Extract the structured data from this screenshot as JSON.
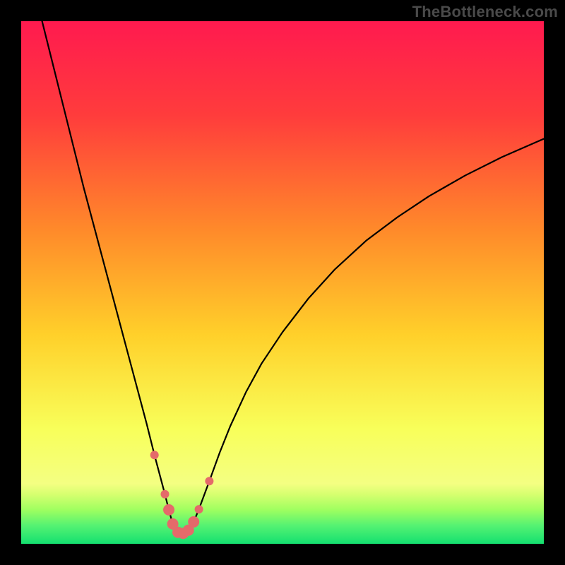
{
  "watermark": "TheBottleneck.com",
  "chart_data": {
    "type": "line",
    "title": "",
    "xlabel": "",
    "ylabel": "",
    "xlim": [
      0,
      100
    ],
    "ylim": [
      0,
      100
    ],
    "background": {
      "type": "vertical-gradient",
      "stops": [
        {
          "pos": 0.0,
          "color": "#ff1a4f"
        },
        {
          "pos": 0.18,
          "color": "#ff3c3c"
        },
        {
          "pos": 0.4,
          "color": "#ff8a2a"
        },
        {
          "pos": 0.6,
          "color": "#ffd02a"
        },
        {
          "pos": 0.78,
          "color": "#f8ff5a"
        },
        {
          "pos": 0.885,
          "color": "#f4ff82"
        },
        {
          "pos": 0.905,
          "color": "#d7ff70"
        },
        {
          "pos": 0.935,
          "color": "#9fff60"
        },
        {
          "pos": 0.965,
          "color": "#55f272"
        },
        {
          "pos": 1.0,
          "color": "#14e070"
        }
      ]
    },
    "series": [
      {
        "name": "bottleneck-curve",
        "color": "#000000",
        "width": 2.2,
        "x": [
          4,
          6,
          8,
          10,
          12,
          14,
          16,
          18,
          20,
          22,
          24,
          25.5,
          27.5,
          28.25,
          29,
          30,
          31,
          32,
          33,
          34,
          36,
          38,
          40,
          43,
          46,
          50,
          55,
          60,
          66,
          72,
          78,
          85,
          92,
          100
        ],
        "y": [
          100,
          92,
          84,
          76,
          68,
          60.5,
          53,
          45.5,
          38,
          30.5,
          23,
          17,
          9.5,
          6.5,
          3.8,
          2.2,
          2.0,
          2.6,
          4.2,
          6.6,
          12,
          17.5,
          22.5,
          29,
          34.5,
          40.5,
          47,
          52.5,
          58,
          62.5,
          66.5,
          70.5,
          74,
          77.5
        ]
      }
    ],
    "markers": [
      {
        "x": 25.5,
        "y": 17,
        "r": 6,
        "color": "#e46a6a"
      },
      {
        "x": 27.5,
        "y": 9.5,
        "r": 6,
        "color": "#e46a6a"
      },
      {
        "x": 28.25,
        "y": 6.5,
        "r": 8,
        "color": "#e46a6a"
      },
      {
        "x": 29.0,
        "y": 3.8,
        "r": 8,
        "color": "#e46a6a"
      },
      {
        "x": 30.0,
        "y": 2.2,
        "r": 8,
        "color": "#e46a6a"
      },
      {
        "x": 31.0,
        "y": 2.0,
        "r": 8,
        "color": "#e46a6a"
      },
      {
        "x": 32.0,
        "y": 2.6,
        "r": 8,
        "color": "#e46a6a"
      },
      {
        "x": 33.0,
        "y": 4.2,
        "r": 8,
        "color": "#e46a6a"
      },
      {
        "x": 34.0,
        "y": 6.6,
        "r": 6,
        "color": "#e46a6a"
      },
      {
        "x": 36.0,
        "y": 12.0,
        "r": 6,
        "color": "#e46a6a"
      }
    ]
  }
}
